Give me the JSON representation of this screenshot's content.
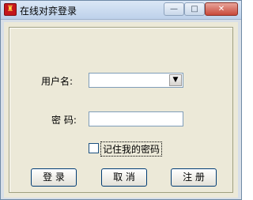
{
  "window": {
    "title": "在线对弈登录",
    "icon": "app-icon",
    "minimize_glyph": "—",
    "maximize_glyph": "□",
    "close_glyph": "✕"
  },
  "form": {
    "username_label": "用户名:",
    "username_value": "",
    "password_label": "密 码:",
    "password_value": "",
    "remember_label": "记住我的密码",
    "remember_checked": false
  },
  "buttons": {
    "login": "登 录",
    "cancel": "取 消",
    "register": "注 册"
  },
  "colors": {
    "client_bg": "#ece9d8",
    "titlebar_top": "#dbe7f6",
    "close_button": "#c8493a",
    "input_border": "#7f9db9"
  }
}
